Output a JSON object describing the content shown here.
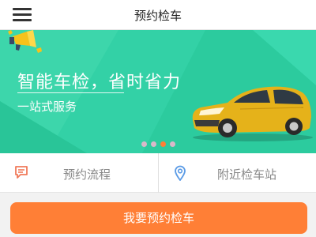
{
  "header": {
    "title": "预约检车",
    "menu_icon": "hamburger-menu-icon"
  },
  "banner": {
    "title": "智能车检，省时省力",
    "subtitle": "一站式服务",
    "background_color": "#2fcfa2",
    "decoration_icon": "megaphone-icon",
    "car_color": "#e5b21a",
    "carousel": {
      "slide_count": 4,
      "active_index": 2,
      "active_color": "#ff7f36",
      "inactive_color": "#d9b9c9"
    }
  },
  "quick_links": [
    {
      "label": "预约流程",
      "icon": "message-icon",
      "icon_color": "#f07a5a"
    },
    {
      "label": "附近检车站",
      "icon": "location-pin-icon",
      "icon_color": "#5b9be6"
    }
  ],
  "cta": {
    "label": "我要预约检车",
    "color": "#ff7f36"
  }
}
